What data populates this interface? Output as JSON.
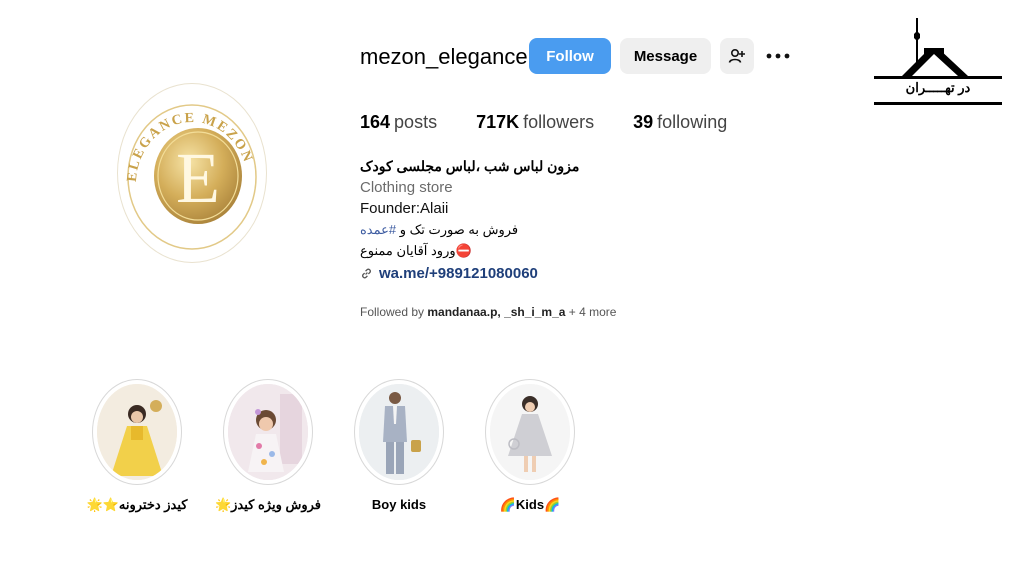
{
  "profile": {
    "username": "mezon_elegance",
    "avatar_text": "ELEGANCE MEZON",
    "avatar_letter": "E"
  },
  "actions": {
    "follow_label": "Follow",
    "message_label": "Message",
    "add_user_icon": "person-add-icon",
    "more_icon": "more-horizontal-icon"
  },
  "stats": {
    "posts_count": "164",
    "posts_label": "posts",
    "followers_count": "717K",
    "followers_label": "followers",
    "following_count": "39",
    "following_label": "following"
  },
  "bio": {
    "name": "مزون لباس شب ،لباس مجلسی کودک",
    "category": "Clothing store",
    "founder": "Founder:Alaii",
    "line_sale_prefix": "فروش به صورت تک و ",
    "line_sale_hashtag": "#عمده",
    "line_no_entry": "⛔ورود آقایان ممنوع",
    "link": "wa.me/+989121080060"
  },
  "followed_by": {
    "prefix": "Followed by ",
    "users": "mandanaa.p, _sh_i_m_a",
    "more": " + 4 more"
  },
  "highlights": [
    {
      "label": "کیدز دخترونه⭐🌟",
      "icon": "girl-yellow-dress-image"
    },
    {
      "label": "فروش ویژه کیدز🌟",
      "icon": "girl-floral-dress-image"
    },
    {
      "label": "Boy kids",
      "icon": "boy-suit-image"
    },
    {
      "label": "🌈Kids🌈",
      "icon": "girl-grey-dress-image"
    }
  ],
  "watermark": {
    "text": "در تهـــــران",
    "icon": "milad-tower-logo"
  },
  "colors": {
    "follow_button": "#4a9cf0",
    "secondary_button": "#efefef",
    "link": "#1f3f7a",
    "gold": "#c9a24a"
  }
}
